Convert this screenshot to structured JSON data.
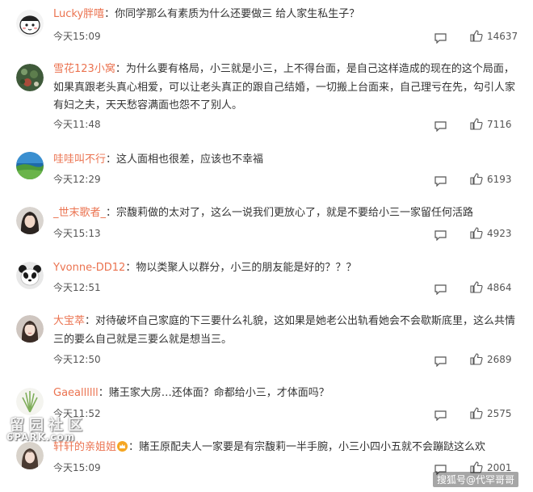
{
  "comments": [
    {
      "user": "Lucky胖嘻",
      "text": "：你同学那么有素质为什么还要做三 给人家生私生子？",
      "time": "今天15:09",
      "likes": "14637",
      "avatar_icon": "cartoon-face-avatar"
    },
    {
      "user": "雪花123小窝",
      "text": "：为什么要有格局，小三就是小三，上不得台面，是自己这样造成的现在的这个局面，如果真跟老头真心相爱，可以让老头真正的跟自己结婚，一切搬上台面来，自己理亏在先，勾引人家有妇之夫，天天愁容满面也怨不了别人。",
      "time": "今天11:48",
      "likes": "7116",
      "avatar_icon": "flower-avatar"
    },
    {
      "user": "哇哇叫不行",
      "text": "：这人面相也很差，应该也不幸福",
      "time": "今天12:29",
      "likes": "6193",
      "avatar_icon": "landscape-avatar"
    },
    {
      "user": "_世末歌者_",
      "text": "：宗馥莉做的太对了，这么一说我们更放心了，就是不要给小三一家留任何活路",
      "time": "今天15:13",
      "likes": "4923",
      "avatar_icon": "woman-avatar"
    },
    {
      "user": "Yvonne-DD12",
      "text": "：物以类聚人以群分，小三的朋友能是好的？？？",
      "time": "今天12:51",
      "likes": "4864",
      "avatar_icon": "panda-avatar"
    },
    {
      "user": "大宝萃",
      "text": "：对待破坏自己家庭的下三要什么礼貌，这如果是她老公出轨看她会不会歇斯底里，这么共情三的要么自己就是三要么就是想当三。",
      "time": "今天12:50",
      "likes": "2689",
      "avatar_icon": "woman-avatar"
    },
    {
      "user": "Gaeallllll",
      "text": "：赌王家大房…还体面？命都给小三，才体面吗？",
      "time": "今天11:52",
      "likes": "2575",
      "avatar_icon": "grass-avatar"
    },
    {
      "user": "轩轩的亲姐姐",
      "text": "：赌王原配夫人一家要是有宗馥莉一半手腕，小三小四小五就不会蹦跶这么欢",
      "time": "今天15:09",
      "likes": "2001",
      "avatar_icon": "girl-avatar",
      "badge_icon": "crown-icon"
    }
  ],
  "icons": {
    "reply": "comment-icon",
    "like": "thumbs-up-icon"
  },
  "watermarks": {
    "left_cn": "留园社区",
    "left_en": "6PARK.com",
    "right": "搜狐号@代罕哥哥"
  },
  "colors": {
    "username": "#eb7350",
    "text": "#333333",
    "meta": "#555555"
  }
}
